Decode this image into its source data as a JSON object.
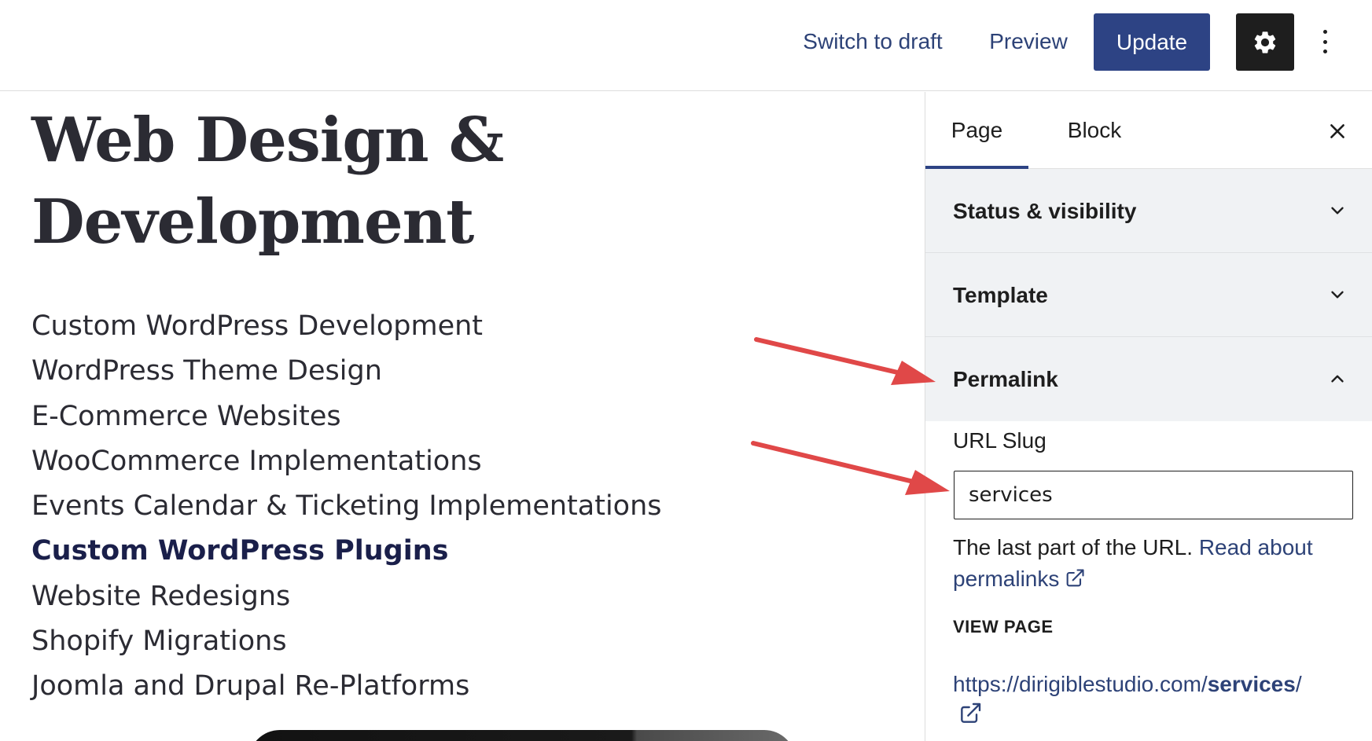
{
  "toolbar": {
    "switch_to_draft": "Switch to draft",
    "preview": "Preview",
    "update": "Update",
    "settings_icon": "gear-icon",
    "more_icon": "more-vertical-icon"
  },
  "content": {
    "title": "Web Design & Development",
    "services": [
      "Custom WordPress Development",
      "WordPress Theme Design",
      "E-Commerce Websites",
      "WooCommerce Implementations",
      "Events Calendar & Ticketing Implementations",
      "Custom WordPress Plugins",
      "Website Redesigns",
      "Shopify Migrations",
      "Joomla and Drupal Re-Platforms"
    ],
    "highlighted_service": "Custom WordPress Plugins"
  },
  "sidebar": {
    "tabs": [
      {
        "label": "Page",
        "active": true
      },
      {
        "label": "Block",
        "active": false
      }
    ],
    "panels": [
      {
        "title": "Status & visibility",
        "expanded": false
      },
      {
        "title": "Template",
        "expanded": false
      },
      {
        "title": "Permalink",
        "expanded": true
      }
    ],
    "permalink": {
      "slug_label": "URL Slug",
      "slug_value": "services",
      "help_text": "The last part of the URL.",
      "help_link": "Read about permalinks",
      "view_page_label": "VIEW PAGE",
      "url_prefix": "https://dirigiblestudio.com/",
      "url_slug": "services",
      "url_suffix": "/"
    }
  },
  "colors": {
    "accent": "#2d4384",
    "link": "#2d4277",
    "annotation_arrow": "#e04848",
    "panel_bg": "#f0f2f4"
  }
}
